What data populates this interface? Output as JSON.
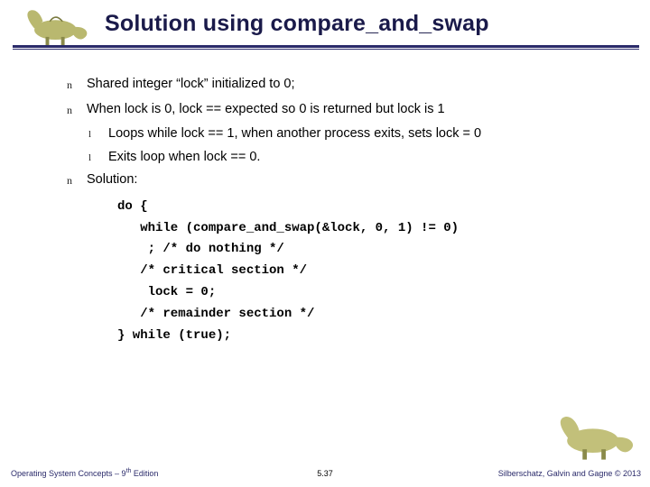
{
  "title": "Solution using compare_and_swap",
  "bullets": [
    {
      "text": "Shared integer  “lock”  initialized to 0;"
    },
    {
      "text": "When lock is 0, lock == expected so 0 is returned but lock is 1",
      "sub": [
        "Loops while lock == 1, when another process exits, sets lock = 0",
        "Exits loop when lock == 0."
      ]
    },
    {
      "text": "Solution:"
    }
  ],
  "code": [
    "do {",
    "   while (compare_and_swap(&lock, 0, 1) != 0)",
    "    ; /* do nothing */",
    "   /* critical section */",
    "    lock = 0;",
    "   /* remainder section */",
    "} while (true);"
  ],
  "footer": {
    "left_prefix": "Operating System Concepts – 9",
    "left_suffix": " Edition",
    "left_sup": "th",
    "center": "5.37",
    "right": "Silberschatz, Galvin and Gagne © 2013"
  },
  "marks": {
    "l1": "n",
    "l2": "l"
  },
  "icons": {
    "dino": "dinosaur-illustration"
  }
}
